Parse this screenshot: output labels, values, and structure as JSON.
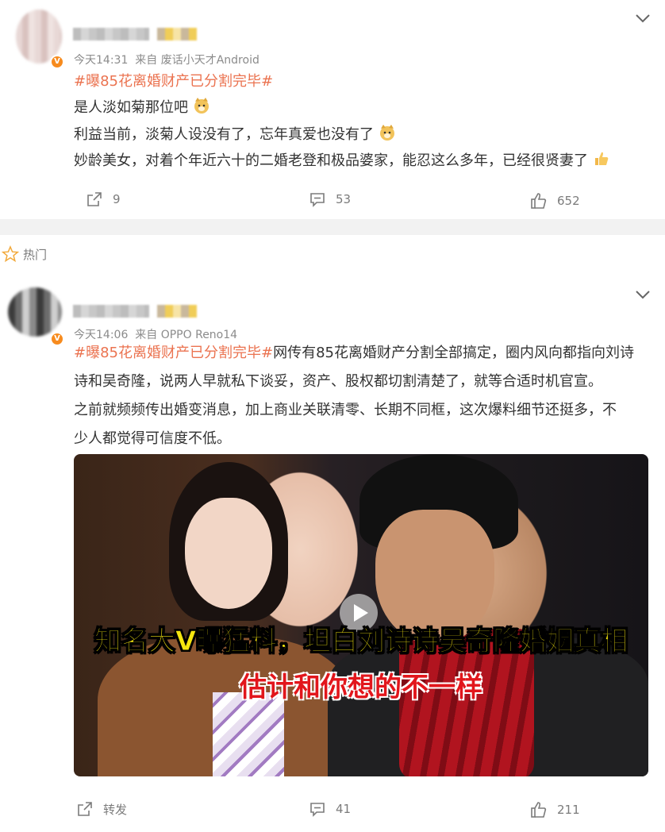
{
  "section": {
    "label": "热门",
    "star_icon": "star-outline-icon"
  },
  "post1": {
    "time": "今天14:31",
    "source": "来自 废话小天才Android",
    "hashtag": "#曝85花离婚财产已分割完毕#",
    "lines": [
      "是人淡如菊那位吧",
      "利益当前，淡菊人设没有了，忘年真爱也没有了",
      "妙龄美女，对着个年近六十的二婚老登和极品婆家，能忍这么多年，已经很贤妻了"
    ],
    "badge": "V",
    "actions": {
      "repost": "9",
      "comments": "53",
      "likes": "652"
    }
  },
  "post2": {
    "time": "今天14:06",
    "source": "来自 OPPO Reno14",
    "hashtag": "#曝85花离婚财产已分割完毕#",
    "line1_rest": "网传有85花离婚财产分割全部搞定，圈内风向都指向刘诗",
    "lines": [
      "诗和吴奇隆，说两人早就私下谈妥，资产、股权都切割清楚了，就等合适时机官宣。",
      "之前就频频传出婚变消息，加上商业关联清零、长期不同框，这次爆料细节还挺多，不",
      "少人都觉得可信度不低。"
    ],
    "badge": "V",
    "video": {
      "caption_yellow": "知名大V曝猛料，坦白刘诗诗吴奇隆婚姻真相",
      "caption_red": "估计和你想的不一样"
    },
    "actions": {
      "repost": "转发",
      "comments": "41",
      "likes": "211"
    }
  },
  "colors": {
    "hashtag": "#eb7350",
    "text": "#333333",
    "meta": "#8b8b8b",
    "badge": "#f78b1e"
  }
}
